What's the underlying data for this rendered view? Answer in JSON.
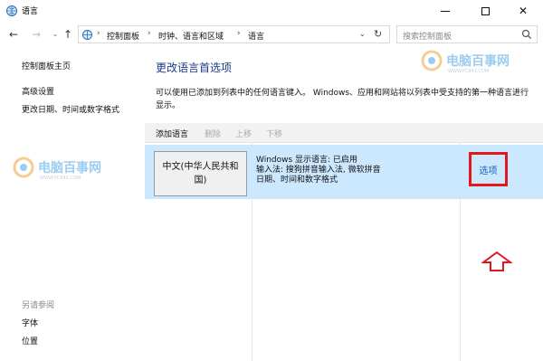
{
  "window": {
    "title": "语言",
    "minimize_icon": "minimize-icon",
    "maximize_icon": "maximize-icon",
    "close_icon": "close-icon"
  },
  "nav": {
    "breadcrumbs": [
      "控制面板",
      "时钟、语言和区域",
      "语言"
    ],
    "search_placeholder": "搜索控制面板"
  },
  "sidebar": {
    "links": [
      "控制面板主页",
      "高级设置",
      "更改日期、时间或数字格式"
    ],
    "see_also_label": "另请参阅",
    "see_also_links": [
      "字体",
      "位置"
    ]
  },
  "main": {
    "title": "更改语言首选项",
    "description": "可以使用已添加到列表中的任何语言键入。 Windows、应用和网站将以列表中受支持的第一种语言进行显示。",
    "toolbar": {
      "add": "添加语言",
      "remove": "删除",
      "move_up": "上移",
      "move_down": "下移"
    },
    "languages": [
      {
        "name": "中文(中华人民共和国)",
        "details": [
          "Windows 显示语言: 已启用",
          "输入法: 搜狗拼音输入法, 微软拼音",
          "日期、时间和数字格式"
        ],
        "options_label": "选项"
      }
    ]
  },
  "watermark": {
    "text": "电脑百事网",
    "sub": "WWW.PC841.COM"
  },
  "colors": {
    "title_blue": "#1a3a8a",
    "link_blue": "#1560bd",
    "selected_row": "#cce8ff",
    "highlight_red": "#e0181e"
  }
}
